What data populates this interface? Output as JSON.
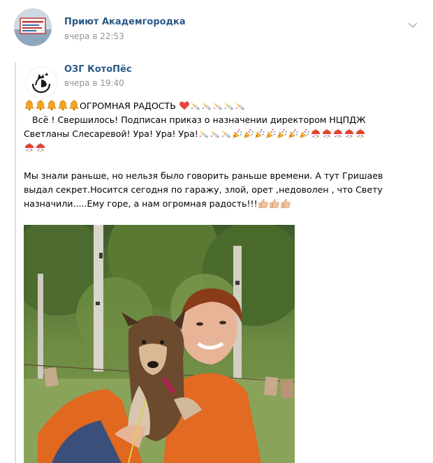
{
  "post": {
    "author": "Приют Академгородка",
    "time": "вчера в 22:53"
  },
  "repost": {
    "author": "ОЗГ КотоПёс",
    "time": "вчера в 19:40",
    "text": {
      "l1": "ОГРОМНАЯ РАДОСТЬ",
      "l2": "   Всё ! Свершилось! Подписан приказ о назначении директором НЦПДЖ",
      "l3": "Светланы Слесаревой! Ура! Ура! Ура!",
      "p2l1": "Мы знали раньше, но нельзя было говорить раньше времени. А тут Гришаев",
      "p2l2": "выдал секрет.Носится сегодня по гаражу, злой, орет ,недоволен , что Свету",
      "p2l3": "назначили.....Ему горе, а нам огромная радость!!!"
    },
    "emoji": {
      "bell": "bell-icon",
      "heart": "red-heart-icon",
      "horn": "party-horn-icon",
      "popper": "party-popper-icon",
      "confetti": "confetti-ball-icon",
      "thumbs": "thumbs-up-icon"
    }
  },
  "colors": {
    "link": "#2a5885",
    "meta": "#939393",
    "repost_bar": "#dae1e8",
    "heart": "#e8453c",
    "bell": "#f0a81f"
  }
}
